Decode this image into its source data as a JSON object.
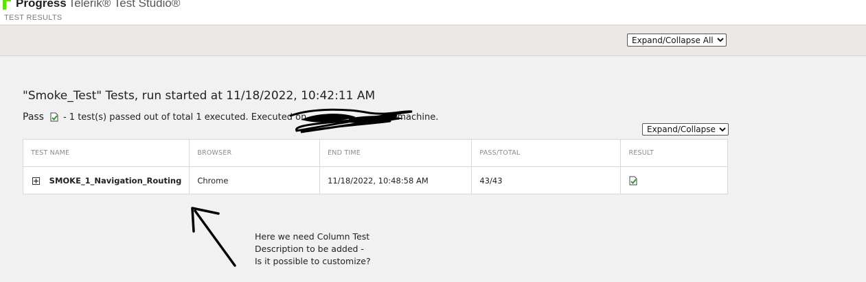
{
  "header": {
    "brand": "Progress",
    "product": "Telerik® Test Studio®",
    "subtitle": "TEST RESULTS"
  },
  "toolbar": {
    "expand_all_label": "Expand/Collapse All",
    "expand_all_options": [
      "Expand/Collapse All"
    ]
  },
  "summary": {
    "title": "\"Smoke_Test\" Tests, run started at 11/18/2022, 10:42:11 AM",
    "status": "Pass",
    "detail": "- 1 test(s) passed out of total 1 executed. Executed on",
    "detail_end": "machine."
  },
  "table": {
    "expand_label": "Expand/Collapse",
    "headers": [
      "TEST NAME",
      "BROWSER",
      "END TIME",
      "PASS/TOTAL",
      "RESULT"
    ],
    "rows": [
      {
        "test_name": "SMOKE_1_Navigation_Routing",
        "browser": "Chrome",
        "end_time": "11/18/2022, 10:48:58 AM",
        "pass_total": "43/43",
        "result_icon": "pass-icon"
      }
    ]
  },
  "annotation": {
    "note": "Here we need Column Test Description to be added - Is it possible to customize?"
  },
  "colors": {
    "brand_green": "#5ce500",
    "pass_green": "#2e9a2e",
    "toolbar_bg": "#ebe8e5",
    "page_bg": "#f1f1f1"
  }
}
